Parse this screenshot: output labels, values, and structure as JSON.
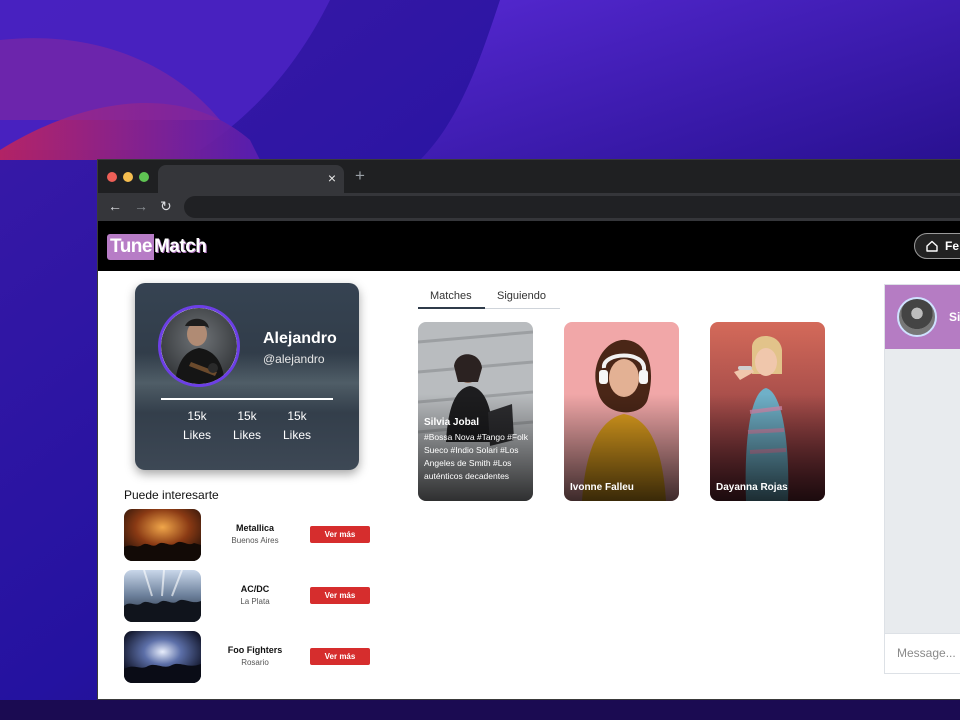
{
  "browser": {
    "tab_close": "×",
    "new_tab": "+",
    "nav_back": "←",
    "nav_forward": "→",
    "nav_reload": "↻"
  },
  "app": {
    "logo_part1": "Tune",
    "logo_part2": "Match",
    "feed_label": "Fe"
  },
  "profile": {
    "name": "Alejandro",
    "handle": "@alejandro",
    "stats": [
      {
        "value": "15k",
        "label": "Likes"
      },
      {
        "value": "15k",
        "label": "Likes"
      },
      {
        "value": "15k",
        "label": "Likes"
      }
    ]
  },
  "suggestions": {
    "title": "Puede interesarte",
    "button_label": "Ver más",
    "items": [
      {
        "name": "Metallica",
        "city": "Buenos Aires"
      },
      {
        "name": "AC/DC",
        "city": "La Plata"
      },
      {
        "name": "Foo Fighters",
        "city": "Rosario"
      }
    ]
  },
  "tabs": [
    {
      "label": "Matches",
      "active": true
    },
    {
      "label": "Siguiendo",
      "active": false
    }
  ],
  "matches": [
    {
      "name": "Silvia Jobal",
      "tags": "#Bossa Nova #Tango #Folk Sueco #Indio Solari #Los Angeles de Smith #Los auténticos decadentes"
    },
    {
      "name": "Ivonne Falleu"
    },
    {
      "name": "Dayanna Rojas"
    }
  ],
  "chat": {
    "contact_name": "Si",
    "message_placeholder": "Message..."
  },
  "colors": {
    "brand_purple": "#b77cc6",
    "accent_red": "#d62d2d",
    "avatar_ring": "#6c3fe6"
  }
}
